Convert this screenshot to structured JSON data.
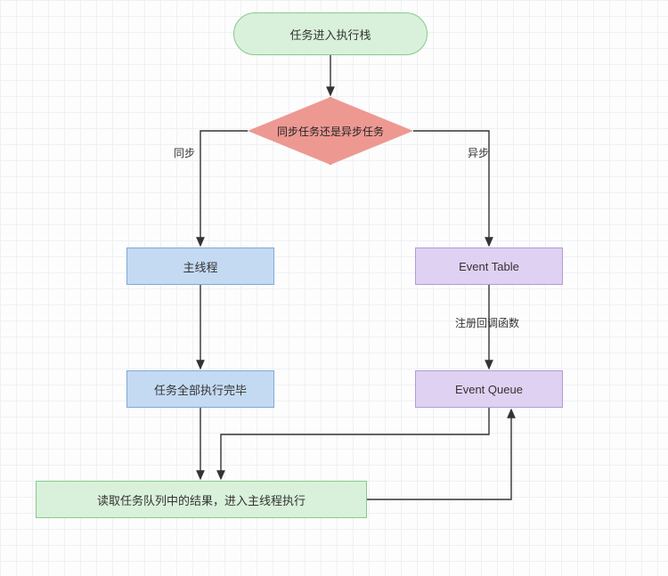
{
  "nodes": {
    "start": "任务进入执行栈",
    "decision": "同步任务还是异步任务",
    "main_thread": "主线程",
    "all_done": "任务全部执行完毕",
    "event_table": "Event Table",
    "event_queue": "Event Queue",
    "result": "读取任务队列中的结果，进入主线程执行"
  },
  "labels": {
    "sync": "同步",
    "async": "异步",
    "register_callback": "注册回调函数"
  },
  "edges": [
    {
      "from": "start",
      "to": "decision"
    },
    {
      "from": "decision",
      "to": "main_thread",
      "label": "sync"
    },
    {
      "from": "decision",
      "to": "event_table",
      "label": "async"
    },
    {
      "from": "main_thread",
      "to": "all_done"
    },
    {
      "from": "event_table",
      "to": "event_queue",
      "label": "register_callback"
    },
    {
      "from": "all_done",
      "to": "result"
    },
    {
      "from": "event_queue",
      "to": "result",
      "routed": "down-left"
    },
    {
      "from": "result",
      "to": "event_queue",
      "routed": "right-up"
    }
  ],
  "colors": {
    "green_fill": "#d9f1da",
    "green_stroke": "#86c98a",
    "red_fill": "#ed9992",
    "red_stroke": "#d96f66",
    "blue_fill": "#c4daf2",
    "blue_stroke": "#7fa8d6",
    "purple_fill": "#dfd1f1",
    "purple_stroke": "#b39ad7"
  }
}
